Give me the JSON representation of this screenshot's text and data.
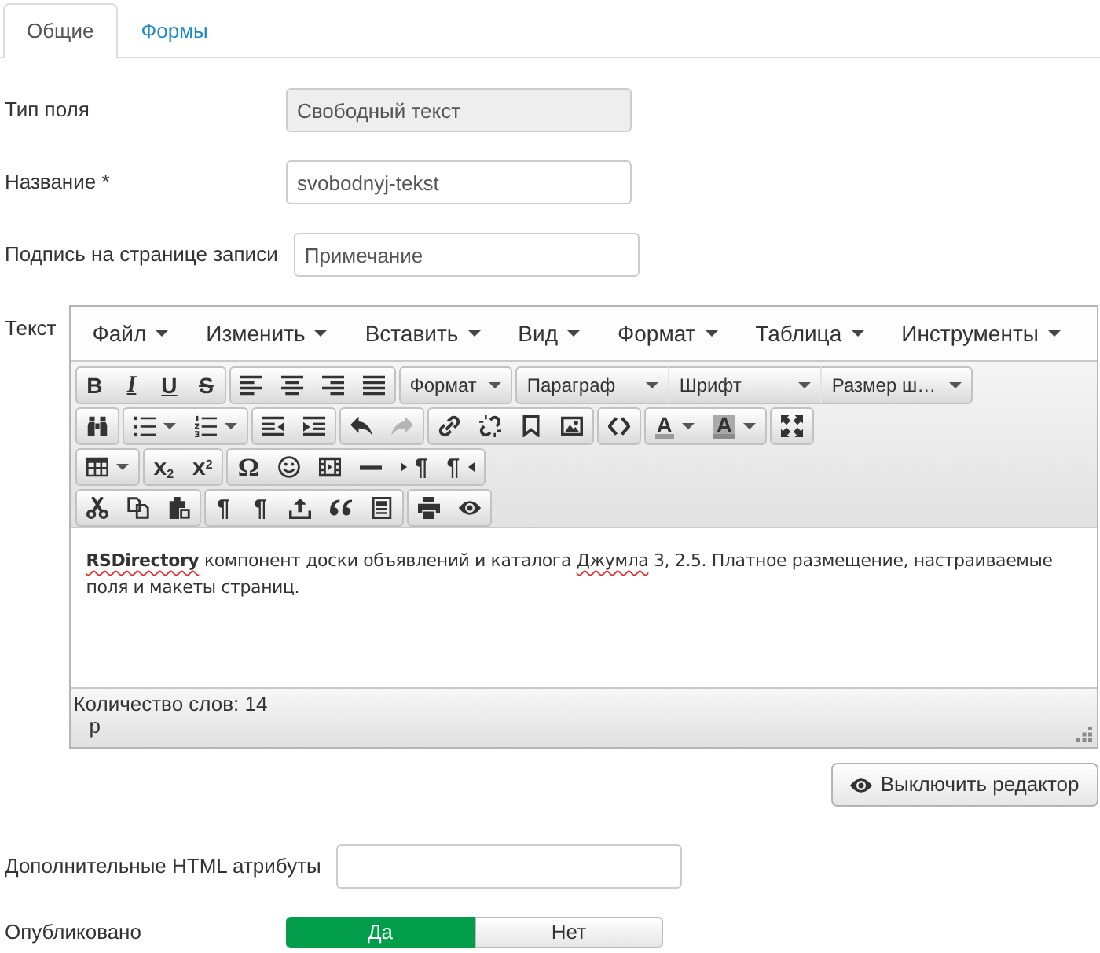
{
  "tabs": [
    {
      "label": "Общие",
      "selected": true
    },
    {
      "label": "Формы",
      "selected": false
    }
  ],
  "fields": [
    {
      "kind": "text",
      "label": "Тип поля",
      "value": "Свободный текст",
      "disabled": true
    },
    {
      "kind": "text",
      "label": "Название *",
      "value": "svobodnyj-tekst",
      "disabled": false
    },
    {
      "kind": "text",
      "label": "Подпись на странице записи",
      "value": "Примечание",
      "disabled": false
    },
    {
      "kind": "editor",
      "label": "Текст",
      "menubar": [
        "Файл",
        "Изменить",
        "Вставить",
        "Вид",
        "Формат",
        "Таблица",
        "Инструменты"
      ],
      "toolbars": [
        [
          [
            {
              "kind": "bold",
              "text": "B",
              "disabled": false
            },
            {
              "kind": "italic",
              "text": "I",
              "disabled": false
            },
            {
              "kind": "underline",
              "text": "U",
              "disabled": false
            },
            {
              "kind": "strikethrough",
              "text": "S",
              "disabled": false
            }
          ],
          [
            {
              "kind": "alignleft",
              "disabled": false
            },
            {
              "kind": "aligncenter",
              "disabled": false
            },
            {
              "kind": "alignright",
              "disabled": false
            },
            {
              "kind": "alignjustify",
              "disabled": false
            }
          ],
          [
            {
              "kind": "listbox",
              "text": "Формат",
              "disabled": false
            }
          ],
          [
            {
              "kind": "listbox",
              "text": "Параграф",
              "disabled": false
            },
            {
              "kind": "listbox",
              "text": "Шрифт",
              "disabled": false
            },
            {
              "kind": "listbox",
              "text": "Размер ш…",
              "disabled": false
            }
          ]
        ],
        [
          [
            {
              "kind": "searchreplace",
              "disabled": false
            }
          ],
          [
            {
              "kind": "bullist",
              "disabled": false
            },
            {
              "kind": "numlist",
              "disabled": false
            }
          ],
          [
            {
              "kind": "outdent",
              "disabled": false
            },
            {
              "kind": "indent",
              "disabled": false
            }
          ],
          [
            {
              "kind": "undo",
              "disabled": false
            },
            {
              "kind": "redo",
              "disabled": true
            }
          ],
          [
            {
              "kind": "link",
              "disabled": false
            },
            {
              "kind": "unlink",
              "disabled": false
            },
            {
              "kind": "anchor",
              "disabled": false
            },
            {
              "kind": "image",
              "disabled": false
            }
          ],
          [
            {
              "kind": "code",
              "disabled": false
            }
          ],
          [
            {
              "kind": "forecolor",
              "text": "A",
              "disabled": false
            },
            {
              "kind": "backcolor",
              "text": "A",
              "disabled": false
            }
          ],
          [
            {
              "kind": "fullscreen",
              "disabled": false
            }
          ]
        ],
        [
          [
            {
              "kind": "table",
              "disabled": false
            }
          ],
          [
            {
              "kind": "subscript",
              "text": "x$_{2}$",
              "disabled": false
            },
            {
              "kind": "superscript",
              "text": "x$^{2}$",
              "disabled": false
            }
          ],
          [
            {
              "kind": "charmap",
              "text": "Ω",
              "disabled": false
            },
            {
              "kind": "emoticons",
              "disabled": false
            },
            {
              "kind": "media",
              "disabled": false
            },
            {
              "kind": "hr",
              "disabled": false
            },
            {
              "kind": "ltr",
              "text": "¶",
              "disabled": false
            },
            {
              "kind": "rtl",
              "text": "¶",
              "disabled": false
            }
          ]
        ],
        [
          [
            {
              "kind": "cut",
              "disabled": false
            },
            {
              "kind": "copy",
              "disabled": false
            },
            {
              "kind": "paste",
              "disabled": false
            }
          ],
          [
            {
              "kind": "pilcrow",
              "text": "¶",
              "disabled": false
            },
            {
              "kind": "pilcrow",
              "text": "¶",
              "disabled": false
            },
            {
              "kind": "upload",
              "disabled": false
            },
            {
              "kind": "blockquote",
              "disabled": false
            },
            {
              "kind": "template",
              "disabled": false
            }
          ],
          [
            {
              "kind": "print",
              "disabled": false
            },
            {
              "kind": "preview",
              "disabled": false
            }
          ]
        ]
      ],
      "content": [
        {
          "text": "**RSDirectory**",
          "misspelled": true
        },
        {
          "text": " компонент доски объявлений и каталога ",
          "misspelled": false
        },
        {
          "text": "Джумла",
          "misspelled": true
        },
        {
          "text": " 3, 2.5. Платное размещение, настраиваемые поля и макеты страниц.",
          "misspelled": false
        }
      ],
      "word_count": "Количество слов: 14",
      "path": "p",
      "toggle_button": "Выключить редактор"
    },
    {
      "kind": "text",
      "label": "Дополнительные HTML атрибуты",
      "disabled": false
    },
    {
      "kind": "toggle",
      "label": "Опубликовано",
      "options": [
        {
          "label": "Да",
          "selected": true
        },
        {
          "label": "Нет",
          "selected": false
        }
      ]
    }
  ]
}
